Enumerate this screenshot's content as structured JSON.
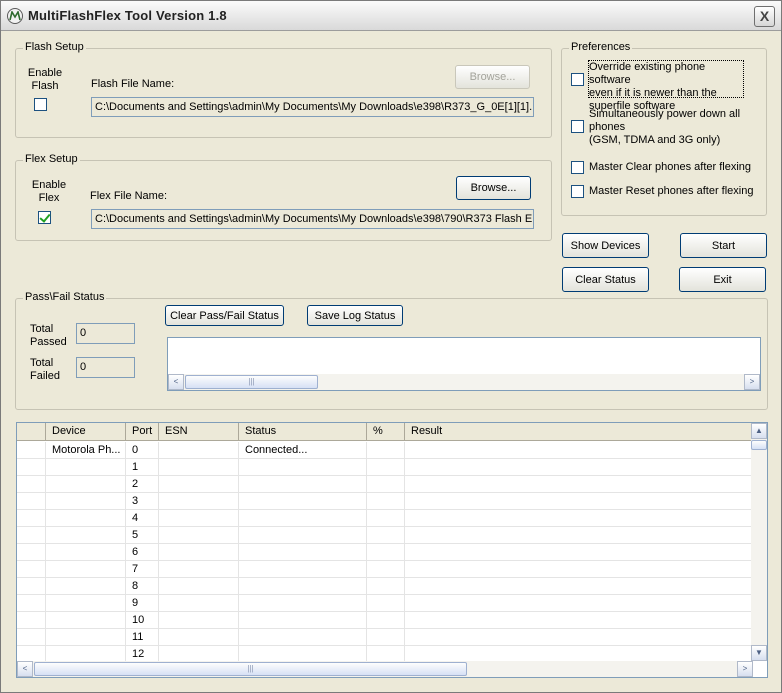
{
  "window": {
    "title": "MultiFlashFlex Tool Version 1.8",
    "app_icon": "motorola-logo-icon",
    "close_label": "X"
  },
  "flash_setup": {
    "group_title": "Flash Setup",
    "enable_label": "Enable Flash",
    "enabled": false,
    "file_label": "Flash File Name:",
    "browse_label": "Browse...",
    "browse_enabled": false,
    "file_path": "C:\\Documents and Settings\\admin\\My Documents\\My Downloads\\e398\\R373_G_0E[1][1]."
  },
  "flex_setup": {
    "group_title": "Flex Setup",
    "enable_label": "Enable Flex",
    "enabled": true,
    "file_label": "Flex File Name:",
    "browse_label": "Browse...",
    "browse_enabled": true,
    "file_path": "C:\\Documents and Settings\\admin\\My Documents\\My Downloads\\e398\\790\\R373 Flash E"
  },
  "preferences": {
    "group_title": "Preferences",
    "options": [
      {
        "line1": "Override existing phone software",
        "line2": "even if it is newer than the",
        "line3": "superfile software",
        "checked": false
      },
      {
        "line1": "Simultaneously power down all",
        "line2": "phones",
        "line3": "(GSM, TDMA and 3G only)",
        "checked": false
      },
      {
        "line1": "Master Clear phones after flexing",
        "checked": false
      },
      {
        "line1": "Master Reset phones after flexing",
        "checked": false
      }
    ]
  },
  "actions": {
    "show_devices": "Show Devices",
    "start": "Start",
    "clear_status": "Clear Status",
    "exit": "Exit"
  },
  "pass_fail": {
    "group_title": "Pass\\Fail Status",
    "total_passed_label": "Total Passed",
    "total_passed": "0",
    "total_failed_label": "Total Failed",
    "total_failed": "0",
    "clear_label": "Clear Pass/Fail Status",
    "save_label": "Save Log Status"
  },
  "grid": {
    "columns": [
      "Device",
      "Port",
      "ESN",
      "Status",
      "%",
      "Result"
    ],
    "rows": [
      {
        "device": "Motorola Ph...",
        "port": "0",
        "esn": "",
        "status": "Connected...",
        "pct": "",
        "result": ""
      },
      {
        "device": "",
        "port": "1",
        "esn": "",
        "status": "",
        "pct": "",
        "result": ""
      },
      {
        "device": "",
        "port": "2",
        "esn": "",
        "status": "",
        "pct": "",
        "result": ""
      },
      {
        "device": "",
        "port": "3",
        "esn": "",
        "status": "",
        "pct": "",
        "result": ""
      },
      {
        "device": "",
        "port": "4",
        "esn": "",
        "status": "",
        "pct": "",
        "result": ""
      },
      {
        "device": "",
        "port": "5",
        "esn": "",
        "status": "",
        "pct": "",
        "result": ""
      },
      {
        "device": "",
        "port": "6",
        "esn": "",
        "status": "",
        "pct": "",
        "result": ""
      },
      {
        "device": "",
        "port": "7",
        "esn": "",
        "status": "",
        "pct": "",
        "result": ""
      },
      {
        "device": "",
        "port": "8",
        "esn": "",
        "status": "",
        "pct": "",
        "result": ""
      },
      {
        "device": "",
        "port": "9",
        "esn": "",
        "status": "",
        "pct": "",
        "result": ""
      },
      {
        "device": "",
        "port": "10",
        "esn": "",
        "status": "",
        "pct": "",
        "result": ""
      },
      {
        "device": "",
        "port": "11",
        "esn": "",
        "status": "",
        "pct": "",
        "result": ""
      },
      {
        "device": "",
        "port": "12",
        "esn": "",
        "status": "",
        "pct": "",
        "result": ""
      }
    ]
  },
  "scroll": {
    "left_arrow": "<",
    "right_arrow": ">",
    "up_arrow": "▲",
    "down_arrow": "▼",
    "thumb_grip": "|||"
  }
}
